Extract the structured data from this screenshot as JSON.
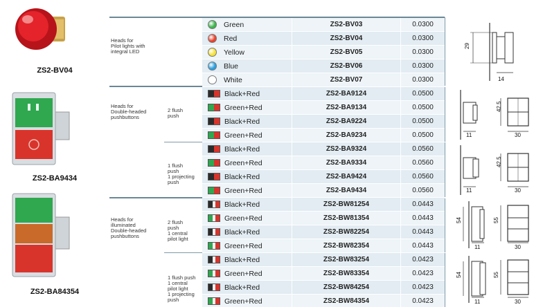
{
  "products": [
    {
      "label": "ZS2-BV04"
    },
    {
      "label": "ZS2-BA9434"
    },
    {
      "label": "ZS2-BA84354"
    }
  ],
  "groups": [
    {
      "desc": [
        "Heads for",
        "Pilot lights with",
        "integral LED"
      ]
    },
    {
      "desc": [
        "Heads for",
        "Double-headed",
        "pushbuttons"
      ]
    },
    {
      "desc": [
        "Heads for",
        "illuminated",
        "Double-headed",
        "pushbuttons"
      ]
    }
  ],
  "subgroups": [
    {
      "text": [
        "2 flush",
        "push"
      ]
    },
    {
      "text": [
        "1 flush",
        "push",
        "1 projecting",
        "push"
      ]
    },
    {
      "text": [
        "2 flush",
        "push",
        "1 central",
        "pilot light"
      ]
    },
    {
      "text": [
        "1 flush push",
        "1 central",
        "pilot light",
        "1 projecting",
        "push"
      ]
    }
  ],
  "rows": [
    {
      "color": "Green",
      "ref": "ZS2-BV03",
      "weight": "0.0300",
      "icon": "dot",
      "c1": "#3cb44b"
    },
    {
      "color": "Red",
      "ref": "ZS2-BV04",
      "weight": "0.0300",
      "icon": "dot",
      "c1": "#e8412c"
    },
    {
      "color": "Yellow",
      "ref": "ZS2-BV05",
      "weight": "0.0300",
      "icon": "dot",
      "c1": "#f5e23a"
    },
    {
      "color": "Blue",
      "ref": "ZS2-BV06",
      "weight": "0.0300",
      "icon": "dot",
      "c1": "#2a9fe0"
    },
    {
      "color": "White",
      "ref": "ZS2-BV07",
      "weight": "0.0300",
      "icon": "dot",
      "c1": "#ffffff"
    },
    {
      "color": "Black+Red",
      "ref": "ZS2-BA9124",
      "weight": "0.0500",
      "icon": "pair",
      "c1": "#2b2b2b",
      "c2": "#d9342b"
    },
    {
      "color": "Green+Red",
      "ref": "ZS2-BA9134",
      "weight": "0.0500",
      "icon": "pair",
      "c1": "#2fa84f",
      "c2": "#d9342b"
    },
    {
      "color": "Black+Red",
      "ref": "ZS2-BA9224",
      "weight": "0.0500",
      "icon": "pair",
      "c1": "#2b2b2b",
      "c2": "#d9342b"
    },
    {
      "color": "Green+Red",
      "ref": "ZS2-BA9234",
      "weight": "0.0500",
      "icon": "pair",
      "c1": "#2fa84f",
      "c2": "#d9342b"
    },
    {
      "color": "Black+Red",
      "ref": "ZS2-BA9324",
      "weight": "0.0560",
      "icon": "pair",
      "c1": "#2b2b2b",
      "c2": "#d9342b"
    },
    {
      "color": "Green+Red",
      "ref": "ZS2-BA9334",
      "weight": "0.0560",
      "icon": "pair",
      "c1": "#2fa84f",
      "c2": "#d9342b"
    },
    {
      "color": "Black+Red",
      "ref": "ZS2-BA9424",
      "weight": "0.0560",
      "icon": "pair",
      "c1": "#2b2b2b",
      "c2": "#d9342b"
    },
    {
      "color": "Green+Red",
      "ref": "ZS2-BA9434",
      "weight": "0.0560",
      "icon": "pair",
      "c1": "#2fa84f",
      "c2": "#d9342b"
    },
    {
      "color": "Black+Red",
      "ref": "ZS2-BW81254",
      "weight": "0.0443",
      "icon": "triple",
      "c1": "#2b2b2b",
      "c2": "#d9342b"
    },
    {
      "color": "Green+Red",
      "ref": "ZS2-BW81354",
      "weight": "0.0443",
      "icon": "triple",
      "c1": "#2fa84f",
      "c2": "#d9342b"
    },
    {
      "color": "Black+Red",
      "ref": "ZS2-BW82254",
      "weight": "0.0443",
      "icon": "triple",
      "c1": "#2b2b2b",
      "c2": "#d9342b"
    },
    {
      "color": "Green+Red",
      "ref": "ZS2-BW82354",
      "weight": "0.0443",
      "icon": "triple",
      "c1": "#2fa84f",
      "c2": "#d9342b"
    },
    {
      "color": "Black+Red",
      "ref": "ZS2-BW83254",
      "weight": "0.0423",
      "icon": "triple",
      "c1": "#2b2b2b",
      "c2": "#d9342b"
    },
    {
      "color": "Green+Red",
      "ref": "ZS2-BW83354",
      "weight": "0.0423",
      "icon": "triple",
      "c1": "#2fa84f",
      "c2": "#d9342b"
    },
    {
      "color": "Black+Red",
      "ref": "ZS2-BW84254",
      "weight": "0.0423",
      "icon": "triple",
      "c1": "#2b2b2b",
      "c2": "#d9342b"
    },
    {
      "color": "Green+Red",
      "ref": "ZS2-BW84354",
      "weight": "0.0423",
      "icon": "triple",
      "c1": "#2fa84f",
      "c2": "#d9342b"
    }
  ],
  "dims": {
    "d1": {
      "h": "29",
      "w": "14"
    },
    "d2": {
      "h": "42.5",
      "a": "11",
      "b": "30"
    },
    "d3": {
      "h": "42.5",
      "a": "11",
      "b": "30"
    },
    "d4": {
      "h1": "54",
      "h2": "55",
      "a": "11",
      "b": "30"
    },
    "d5": {
      "h1": "54",
      "h2": "55",
      "a": "11",
      "b": "30"
    }
  }
}
